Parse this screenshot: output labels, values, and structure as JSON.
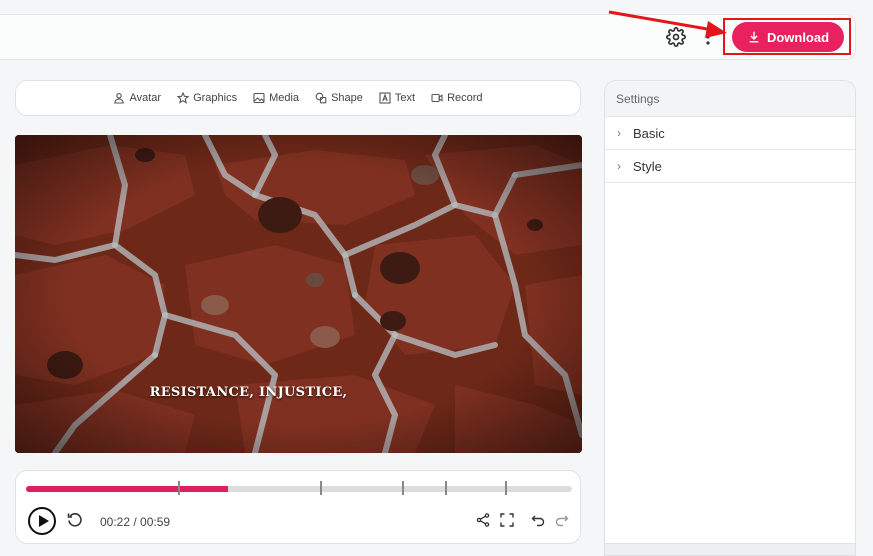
{
  "header": {
    "download_label": "Download",
    "accent_color": "#e8215f",
    "highlight_color": "#e3161c"
  },
  "toolbar": {
    "items": [
      {
        "label": "Avatar",
        "icon": "person-icon"
      },
      {
        "label": "Graphics",
        "icon": "star-icon"
      },
      {
        "label": "Media",
        "icon": "image-icon"
      },
      {
        "label": "Shape",
        "icon": "shapes-icon"
      },
      {
        "label": "Text",
        "icon": "text-box-icon"
      },
      {
        "label": "Record",
        "icon": "video-camera-icon"
      }
    ]
  },
  "canvas": {
    "caption": "RESISTANCE, INJUSTICE,"
  },
  "player": {
    "timecode": "00:22 / 00:59",
    "progress": 0.37,
    "markers": [
      0.28,
      0.54,
      0.69,
      0.77,
      0.88
    ]
  },
  "settings": {
    "title": "Settings",
    "sections": [
      {
        "label": "Basic"
      },
      {
        "label": "Style"
      }
    ]
  }
}
